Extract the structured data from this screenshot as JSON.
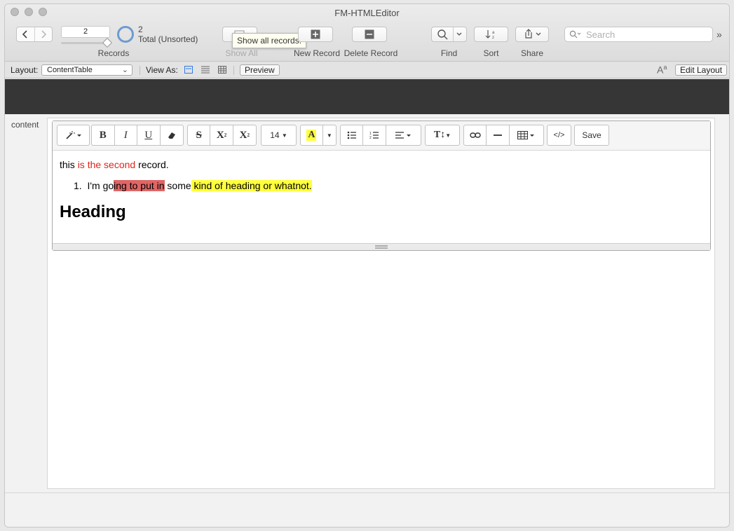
{
  "window": {
    "title": "FM-HTMLEditor"
  },
  "toolbar": {
    "record_number": "2",
    "records_label": "Records",
    "found_count": "2",
    "found_status": "Total (Unsorted)",
    "show_all_label": "Show All",
    "show_all_tooltip": "Show all records.",
    "new_record_label": "New Record",
    "delete_record_label": "Delete Record",
    "find_label": "Find",
    "sort_label": "Sort",
    "share_label": "Share",
    "search_placeholder": "Search"
  },
  "layoutbar": {
    "layout_label": "Layout:",
    "layout_value": "ContentTable",
    "view_as_label": "View As:",
    "preview_label": "Preview",
    "edit_layout_label": "Edit Layout"
  },
  "body": {
    "field_label": "content"
  },
  "editor": {
    "font_size": "14",
    "save_label": "Save",
    "line1": {
      "plain1": "this ",
      "red": "is the second",
      "plain2": " record."
    },
    "list_item": {
      "number": "1.",
      "plain1": "I'm go",
      "red_hl": "ing to put in",
      "plain2": " some",
      "yellow_hl": " kind of heading or whatnot."
    },
    "heading": "Heading"
  },
  "colors": {
    "header_band": "#363636",
    "red_text": "#e2231a",
    "red_highlight": "#e06666",
    "yellow_highlight": "#ffff3c",
    "view_form_active": "#2f7be5"
  }
}
